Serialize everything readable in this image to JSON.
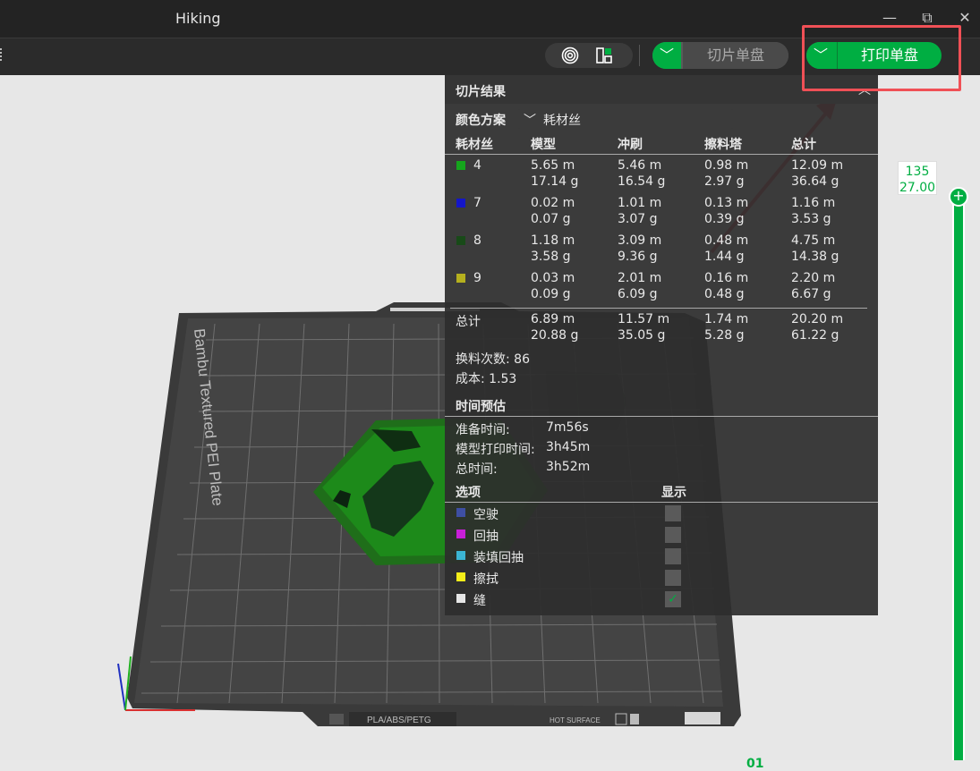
{
  "window": {
    "title": "Hiking",
    "minimize": "—",
    "restore": "⧉",
    "close": "✕"
  },
  "toolbar": {
    "slice_button": "切片单盘",
    "print_button": "打印单盘",
    "dropdown_glyph": "﹀"
  },
  "panel": {
    "title": "切片结果",
    "color_scheme_label": "颜色方案",
    "color_scheme_value": "耗材丝",
    "columns": [
      "耗材丝",
      "模型",
      "冲刷",
      "擦料塔",
      "总计"
    ],
    "rows": [
      {
        "id": "4",
        "color": "#15a51c",
        "model": [
          "5.65 m",
          "17.14 g"
        ],
        "flush": [
          "5.46 m",
          "16.54 g"
        ],
        "tower": [
          "0.98 m",
          "2.97 g"
        ],
        "total": [
          "12.09 m",
          "36.64 g"
        ]
      },
      {
        "id": "7",
        "color": "#1416c8",
        "model": [
          "0.02 m",
          "0.07 g"
        ],
        "flush": [
          "1.01 m",
          "3.07 g"
        ],
        "tower": [
          "0.13 m",
          "0.39 g"
        ],
        "total": [
          "1.16 m",
          "3.53 g"
        ]
      },
      {
        "id": "8",
        "color": "#184a18",
        "model": [
          "1.18 m",
          "3.58 g"
        ],
        "flush": [
          "3.09 m",
          "9.36 g"
        ],
        "tower": [
          "0.48 m",
          "1.44 g"
        ],
        "total": [
          "4.75 m",
          "14.38 g"
        ]
      },
      {
        "id": "9",
        "color": "#b5b01e",
        "model": [
          "0.03 m",
          "0.09 g"
        ],
        "flush": [
          "2.01 m",
          "6.09 g"
        ],
        "tower": [
          "0.16 m",
          "0.48 g"
        ],
        "total": [
          "2.20 m",
          "6.67 g"
        ]
      }
    ],
    "total_row": {
      "label": "总计",
      "model": [
        "6.89 m",
        "20.88 g"
      ],
      "flush": [
        "11.57 m",
        "35.05 g"
      ],
      "tower": [
        "1.74 m",
        "5.28 g"
      ],
      "total": [
        "20.20 m",
        "61.22 g"
      ]
    },
    "filament_changes": "换料次数:  86",
    "cost": "成本:  1.53",
    "time_section": "时间预估",
    "prep_label": "准备时间:",
    "prep_value": "7m56s",
    "model_label": "模型打印时间:",
    "model_value": "3h45m",
    "total_time_label": "总时间:",
    "total_time_value": "3h52m",
    "options_header": "选项",
    "display_header": "显示",
    "options": [
      {
        "label": "空驶",
        "color": "#3e4fa3",
        "checked": false
      },
      {
        "label": "回抽",
        "color": "#c81fd8",
        "checked": false
      },
      {
        "label": "装填回抽",
        "color": "#3bb5d3",
        "checked": false
      },
      {
        "label": "擦拭",
        "color": "#f4ee19",
        "checked": false
      },
      {
        "label": "缝",
        "color": "#e6e6e6",
        "checked": true
      }
    ]
  },
  "slider": {
    "layer": "135",
    "height": "27.00",
    "knob": "+"
  },
  "plate": {
    "brand": "Bambu Textured PEI Plate",
    "materials": "PLA/ABS/PETG",
    "hot_surface": "HOT SURFACE",
    "plate_number": "01"
  }
}
